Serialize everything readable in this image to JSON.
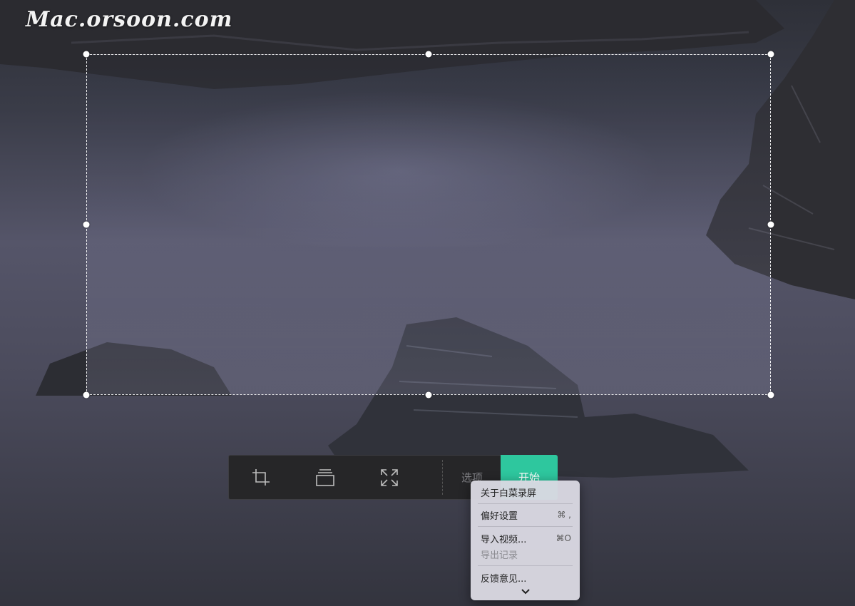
{
  "watermark": "Mac.orsoon.com",
  "toolbar": {
    "crop_tool": "crop-icon",
    "window_tool": "window-icon",
    "fullscreen_tool": "fullscreen-icon",
    "options_label": "选项",
    "start_label": "开始"
  },
  "menu": {
    "about": "关于白菜录屏",
    "preferences": "偏好设置",
    "preferences_shortcut": "⌘ ,",
    "import_video": "导入视频...",
    "import_shortcut": "⌘O",
    "export_records": "导出记录",
    "feedback": "反馈意见..."
  },
  "colors": {
    "accent": "#2ec79e",
    "toolbar_bg": "#262628",
    "menu_bg": "#dad9e2"
  }
}
